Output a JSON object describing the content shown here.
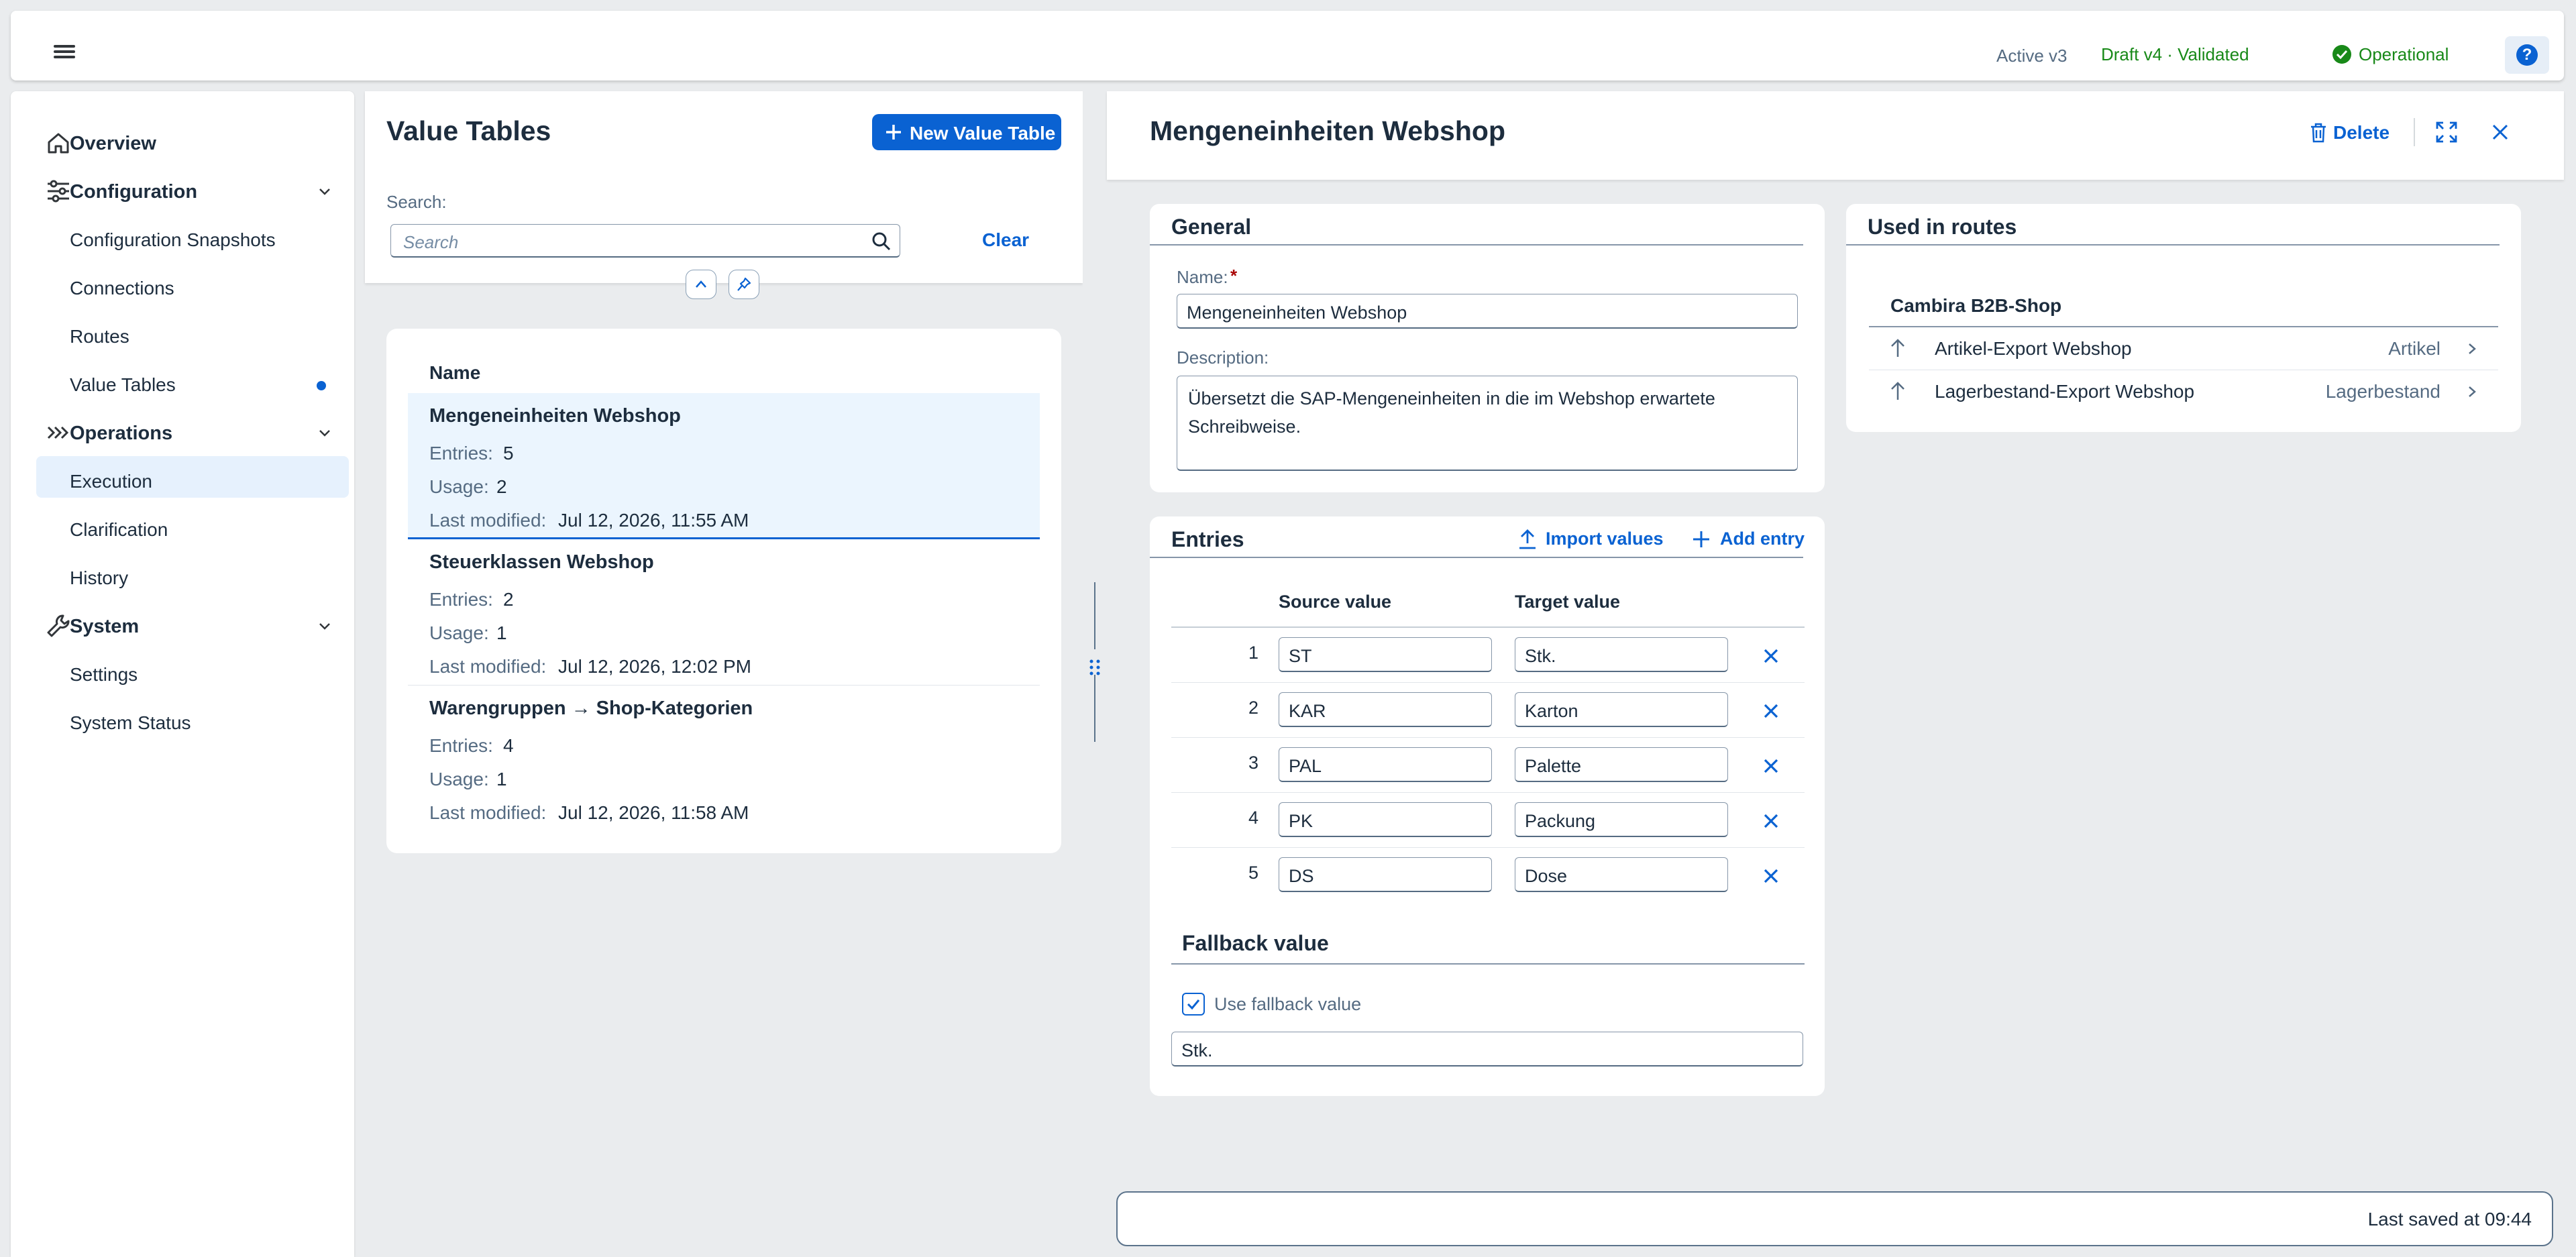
{
  "header": {
    "active_version": "Active v3",
    "draft_version": "Draft v4 · Validated",
    "status": "Operational",
    "help_label": "?",
    "colors": {
      "accent": "#0a62d2",
      "success": "#188918"
    }
  },
  "nav": {
    "overview": "Overview",
    "configuration": "Configuration",
    "configuration_items": [
      "Configuration Snapshots",
      "Connections",
      "Routes",
      "Value Tables"
    ],
    "operations": "Operations",
    "operations_items": [
      "Execution",
      "Clarification",
      "History"
    ],
    "system": "System",
    "system_items": [
      "Settings",
      "System Status"
    ],
    "selected": "Value Tables"
  },
  "list": {
    "title": "Value Tables",
    "new_button": "New Value Table",
    "search_label": "Search:",
    "search_placeholder": "Search",
    "clear": "Clear",
    "column_name": "Name",
    "entries_label": "Entries:",
    "usage_label": "Usage:",
    "modified_label": "Last modified:",
    "items": [
      {
        "name": "Mengeneinheiten Webshop",
        "entries": "5",
        "usage": "2",
        "modified": "Jul 12, 2026, 11:55 AM"
      },
      {
        "name": "Steuerklassen Webshop",
        "entries": "2",
        "usage": "1",
        "modified": "Jul 12, 2026, 12:02 PM"
      },
      {
        "name": "Warengruppen → Shop-Kategorien",
        "entries": "4",
        "usage": "1",
        "modified": "Jul 12, 2026, 11:58 AM"
      }
    ]
  },
  "detail": {
    "title": "Mengeneinheiten Webshop",
    "delete": "Delete",
    "general": {
      "title": "General",
      "name_label": "Name:",
      "required": "*",
      "name_value": "Mengeneinheiten Webshop",
      "description_label": "Description:",
      "description_value": "Übersetzt die SAP-Mengeneinheiten in die im Webshop erwartete Schreibweise."
    },
    "routes": {
      "title": "Used in routes",
      "group": "Cambira B2B-Shop",
      "items": [
        {
          "name": "Artikel-Export Webshop",
          "tag": "Artikel"
        },
        {
          "name": "Lagerbestand-Export Webshop",
          "tag": "Lagerbestand"
        }
      ]
    },
    "entries": {
      "title": "Entries",
      "import": "Import values",
      "add": "Add entry",
      "col_source": "Source value",
      "col_target": "Target value",
      "rows": [
        {
          "n": "1",
          "source": "ST",
          "target": "Stk."
        },
        {
          "n": "2",
          "source": "KAR",
          "target": "Karton"
        },
        {
          "n": "3",
          "source": "PAL",
          "target": "Palette"
        },
        {
          "n": "4",
          "source": "PK",
          "target": "Packung"
        },
        {
          "n": "5",
          "source": "DS",
          "target": "Dose"
        }
      ]
    },
    "fallback": {
      "title": "Fallback value",
      "checkbox_label": "Use fallback value",
      "checked": true,
      "value": "Stk."
    }
  },
  "footer": {
    "saved": "Last saved at 09:44"
  }
}
